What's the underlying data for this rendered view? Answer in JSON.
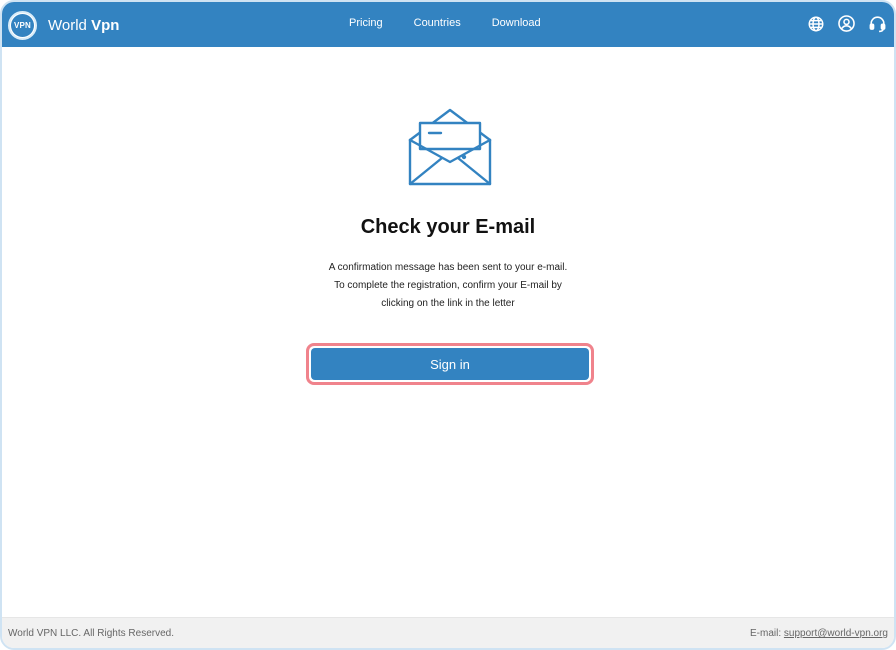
{
  "header": {
    "logo_text": "VPN",
    "brand_prefix": "World",
    "brand_suffix": "Vpn",
    "nav": [
      "Pricing",
      "Countries",
      "Download"
    ],
    "icons": [
      "globe-icon",
      "user-account-icon",
      "support-headset-icon"
    ]
  },
  "main": {
    "icon": "open-envelope-icon",
    "title": "Check your E-mail",
    "message_lines": [
      "A confirmation message has been sent to your e-mail.",
      "To complete the registration, confirm your E-mail by",
      "clicking on the link in the letter"
    ],
    "signin_label": "Sign in"
  },
  "footer": {
    "copyright": "World VPN LLC. All Rights Reserved.",
    "email_label": "E-mail:",
    "email": "support@world-vpn.org"
  },
  "colors": {
    "primary": "#3383c1",
    "highlight_border": "#f0838c",
    "footer_bg": "#f1f1f1"
  }
}
